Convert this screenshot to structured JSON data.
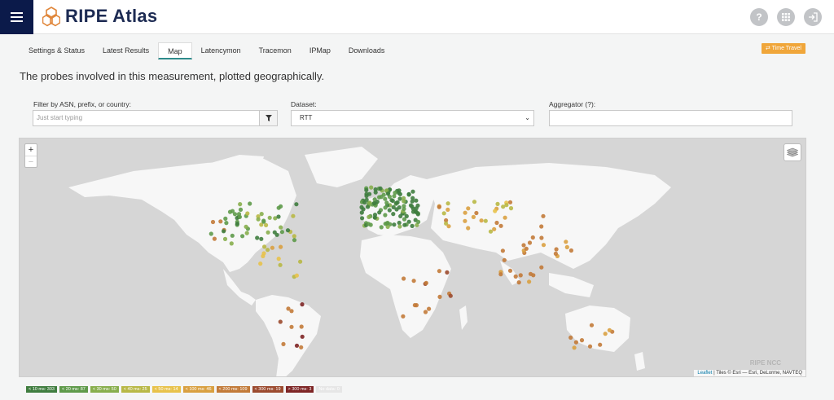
{
  "app": {
    "name": "RIPE Atlas"
  },
  "header_icons": [
    {
      "name": "help-icon",
      "glyph": "?"
    },
    {
      "name": "apps-icon",
      "glyph": "⠿"
    },
    {
      "name": "login-icon",
      "glyph": "⇥"
    }
  ],
  "tabs": [
    {
      "label": "Settings & Status",
      "active": false
    },
    {
      "label": "Latest Results",
      "active": false
    },
    {
      "label": "Map",
      "active": true
    },
    {
      "label": "Latencymon",
      "active": false
    },
    {
      "label": "Tracemon",
      "active": false
    },
    {
      "label": "IPMap",
      "active": false
    },
    {
      "label": "Downloads",
      "active": false
    }
  ],
  "time_travel": "⇄ Time Travel",
  "description": "The probes involved in this measurement, plotted geographically.",
  "filter": {
    "label": "Filter by ASN, prefix, or country:",
    "placeholder": "Just start typing"
  },
  "dataset": {
    "label": "Dataset:",
    "value": "RTT"
  },
  "aggregator": {
    "label": "Aggregator (?):",
    "value": ""
  },
  "map": {
    "zoom_in": "+",
    "zoom_out": "−",
    "attribution_link": "Leaflet",
    "attribution_text": " | Tiles © Esri — Esri, DeLorme, NAVTEQ",
    "watermark": "RIPE NCC"
  },
  "legend": [
    {
      "label": "< 10 ms: 303",
      "color": "#3f7d3f"
    },
    {
      "label": "< 20 ms: 87",
      "color": "#5e9a4a"
    },
    {
      "label": "< 30 ms: 50",
      "color": "#87ae4c"
    },
    {
      "label": "< 40 ms: 25",
      "color": "#b8b845"
    },
    {
      "label": "< 50 ms: 14",
      "color": "#e8c24a"
    },
    {
      "label": "< 100 ms: 46",
      "color": "#d9a040"
    },
    {
      "label": "< 200 ms: 109",
      "color": "#c27a38"
    },
    {
      "label": "< 300 ms: 19",
      "color": "#9b4a2e"
    },
    {
      "label": "> 300 ms: 3",
      "color": "#7d2424"
    },
    {
      "label": "No data: 0",
      "color": "#e6e6e6"
    }
  ]
}
